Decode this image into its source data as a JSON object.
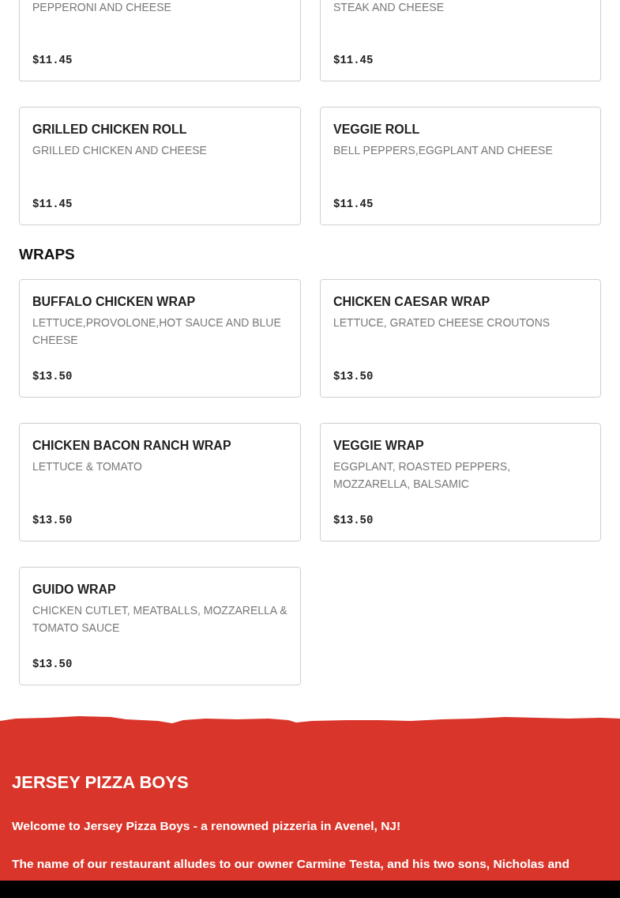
{
  "sections": [
    {
      "items": [
        {
          "description": "PEPPERONI AND CHEESE",
          "price": "$11.45"
        },
        {
          "description": "STEAK AND CHEESE",
          "price": "$11.45"
        },
        {
          "name": "GRILLED CHICKEN ROLL",
          "description": "GRILLED CHICKEN AND CHEESE",
          "price": "$11.45"
        },
        {
          "name": "VEGGIE ROLL",
          "description": "BELL PEPPERS,EGGPLANT AND CHEESE",
          "price": "$11.45"
        }
      ]
    },
    {
      "title": "WRAPS",
      "items": [
        {
          "name": "BUFFALO CHICKEN WRAP",
          "description": "LETTUCE,PROVOLONE,HOT SAUCE AND BLUE CHEESE",
          "price": "$13.50"
        },
        {
          "name": "CHICKEN CAESAR WRAP",
          "description": "LETTUCE, GRATED CHEESE CROUTONS",
          "price": "$13.50"
        },
        {
          "name": "CHICKEN BACON RANCH WRAP",
          "description": "LETTUCE & TOMATO",
          "price": "$13.50"
        },
        {
          "name": "VEGGIE WRAP",
          "description": "EGGPLANT, ROASTED PEPPERS, MOZZARELLA, BALSAMIC",
          "price": "$13.50"
        },
        {
          "name": "GUIDO WRAP",
          "description": "CHICKEN CUTLET, MEATBALLS, MOZZARELLA & TOMATO SAUCE",
          "price": "$13.50"
        }
      ]
    }
  ],
  "footer": {
    "title": "JERSEY PIZZA BOYS",
    "paragraphs": [
      "Welcome to Jersey Pizza Boys - a renowned pizzeria in Avenel, NJ!",
      "The name of our restaurant alludes to our owner Carmine Testa, and his two sons, Nicholas and"
    ]
  }
}
